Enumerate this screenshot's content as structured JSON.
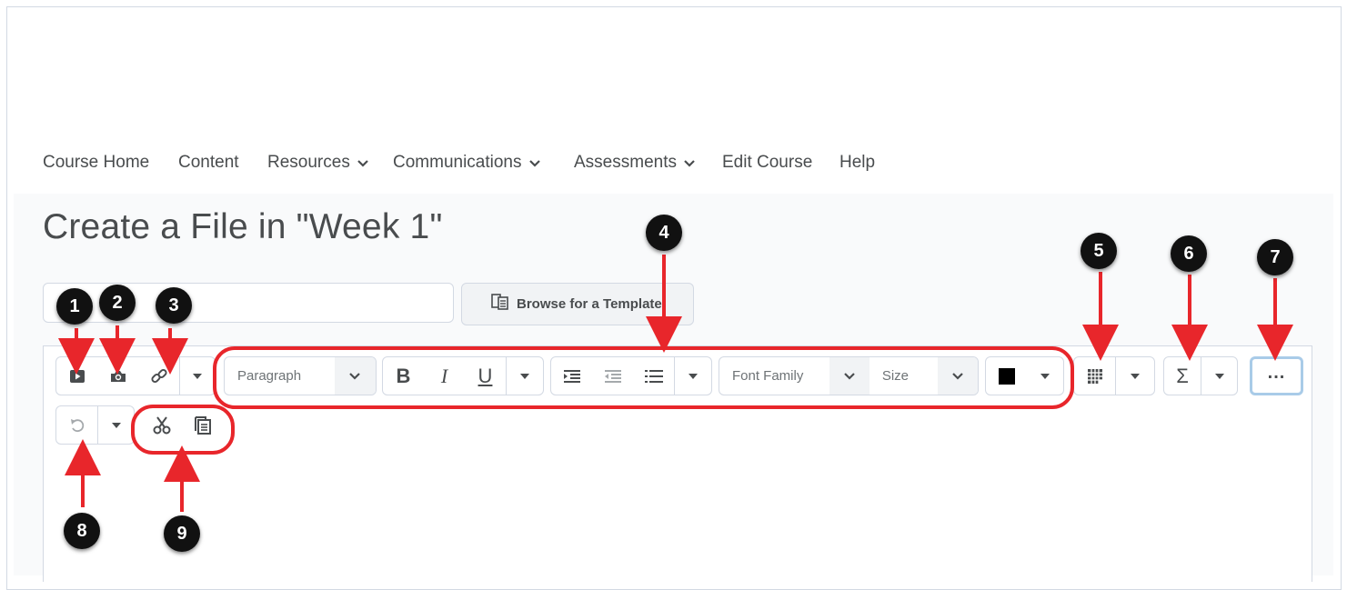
{
  "nav": {
    "items": [
      {
        "label": "Course Home",
        "dropdown": false
      },
      {
        "label": "Content",
        "dropdown": false
      },
      {
        "label": "Resources",
        "dropdown": true
      },
      {
        "label": "Communications",
        "dropdown": true
      },
      {
        "label": "Assessments",
        "dropdown": true
      },
      {
        "label": "Edit Course",
        "dropdown": false
      },
      {
        "label": "Help",
        "dropdown": false
      }
    ]
  },
  "page": {
    "title": "Create a File in \"Week 1\"",
    "title_input_value": "",
    "browse_template_label": "Browse for a Template"
  },
  "toolbar": {
    "block_format": "Paragraph",
    "bold": "B",
    "italic": "I",
    "underline": "U",
    "font_family": "Font Family",
    "font_size": "Size",
    "equation": "Σ",
    "more": "..."
  },
  "annotations": {
    "badges": [
      "1",
      "2",
      "3",
      "4",
      "5",
      "6",
      "7",
      "8",
      "9"
    ],
    "color": "#e8262b"
  },
  "colors": {
    "focus_outline": "#a9cbe8",
    "text": "#494c4e",
    "border": "#d3d9e3"
  }
}
